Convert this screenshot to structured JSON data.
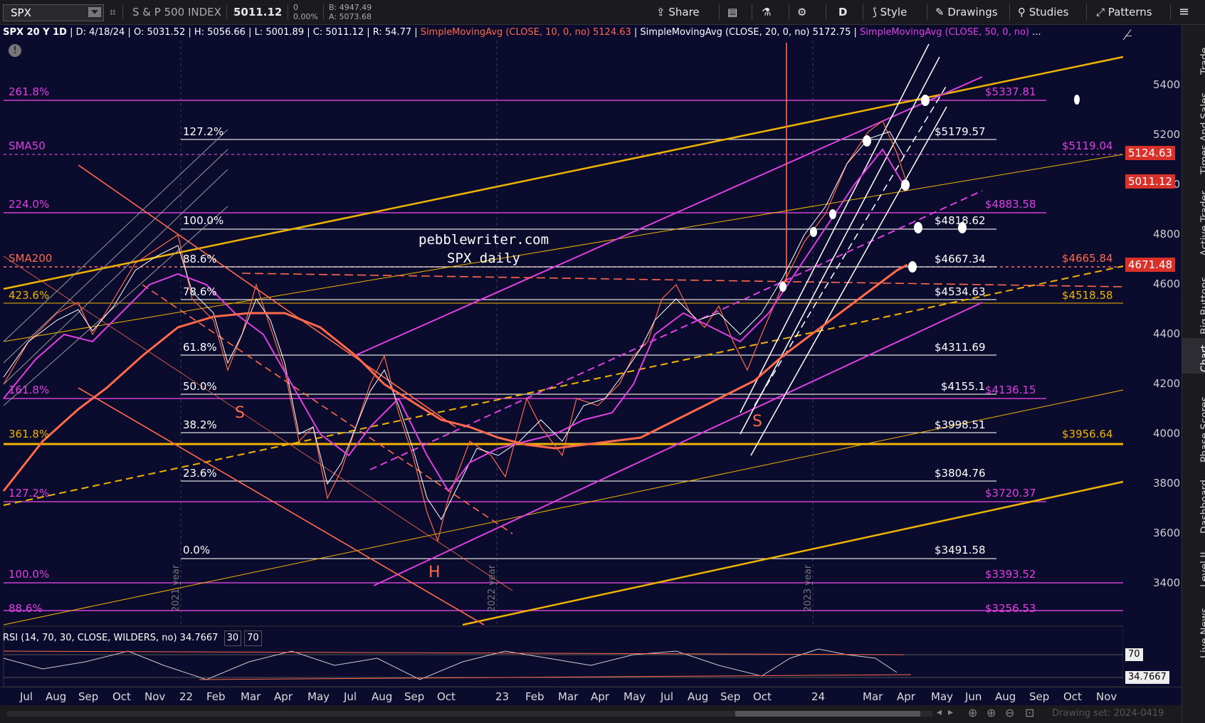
{
  "toolbar": {
    "symbol": "SPX",
    "name": "S & P 500 INDEX",
    "last": "5011.12",
    "change": "0",
    "change_pct": "0.00%",
    "bid": "B: 4947.49",
    "ask": "A: 5073.68",
    "share": "Share",
    "period": "D",
    "style": "Style",
    "drawings": "Drawings",
    "studies": "Studies",
    "patterns": "Patterns"
  },
  "info": {
    "title": "SPX 20 Y 1D",
    "date": "D: 4/18/24",
    "open": "O: 5031.52",
    "high": "H: 5056.66",
    "low": "L: 5001.89",
    "close": "C: 5011.12",
    "range": "R: 54.77",
    "sma10": "SimpleMovingAvg (CLOSE, 10, 0, no)",
    "sma10_val": "5124.63",
    "sma20": "SimpleMovingAvg (CLOSE, 20, 0, no)",
    "sma20_val": "5172.75",
    "sma50": "SimpleMovingAvg (CLOSE, 50, 0, no)",
    "more": "..."
  },
  "rsi": {
    "label": "RSI (14, 70, 30, CLOSE, WILDERS, no)",
    "value": "34.7667",
    "hi": "30",
    "lo": "70",
    "tag70": "70",
    "tag_val": "34.7667"
  },
  "watermark": {
    "line1": "pebblewriter.com",
    "line2": "SPX daily"
  },
  "letters": {
    "s1": "S",
    "h": "H",
    "s2": "S"
  },
  "price_ticks": [
    "5400",
    "5200",
    "5000",
    "4800",
    "4600",
    "4400",
    "4200",
    "4000",
    "3800",
    "3600",
    "3400"
  ],
  "tags": {
    "sma10": "5124.63",
    "last": "5011.12",
    "sma200": "4671.48"
  },
  "fib_left": {
    "f2618": "261.8%",
    "sma50": "SMA50",
    "f224": "224.0%",
    "sma200": "SMA200",
    "f4236": "423.6%",
    "f1618": "161.8%",
    "f3618": "361.8%",
    "f1272": "127.2%",
    "f100": "100.0%",
    "f886": "88.6%"
  },
  "fib_mid": {
    "f1272": "127.2%",
    "f100": "100.0%",
    "f886": "88.6%",
    "f786": "78.6%",
    "f618": "61.8%",
    "f50": "50.0%",
    "f382": "38.2%",
    "f236": "23.6%",
    "f0": "0.0%"
  },
  "fib_mid_prices": [
    "$5179.57",
    "$4818.62",
    "$4667.34",
    "$4534.63",
    "$4311.69",
    "$4155.1",
    "$3998.51",
    "$3804.76",
    "$3491.58"
  ],
  "fib_right_prices": {
    "p5337": "$5337.81",
    "p5119": "$5119.04",
    "p4883": "$4883.58",
    "p4665": "$4665.84",
    "p4518": "$4518.58",
    "p4136": "$4136.15",
    "p3956": "$3956.64",
    "p3720": "$3720.37",
    "p3393": "$3393.52",
    "p3256": "$3256.53"
  },
  "year_labels": [
    "2021 year",
    "2022 year",
    "2023 year"
  ],
  "x_labels": [
    "Jul",
    "Aug",
    "Sep",
    "Oct",
    "Nov",
    "22",
    "Feb",
    "Mar",
    "Apr",
    "May",
    "Jul",
    "Aug",
    "Sep",
    "Oct",
    "23",
    "Feb",
    "Mar",
    "Apr",
    "May",
    "Jul",
    "Aug",
    "Sep",
    "Oct",
    "24",
    "Mar",
    "Apr",
    "May",
    "Jun",
    "Aug",
    "Sep",
    "Oct",
    "Nov"
  ],
  "sidebar": [
    "Trade",
    "Times And Sales",
    "Active Trader",
    "Big Buttons",
    "Chart",
    "Phase Scores",
    "Dashboard",
    "Level II",
    "Live News"
  ],
  "bottom": {
    "drawing_set": "Drawing set: 2024-0419"
  },
  "colors": {
    "bg": "#0b0b2e",
    "magenta": "#e040e0",
    "orange": "#ff6a4a",
    "gold": "#f0b400",
    "white": "#ffffff"
  },
  "icons": [
    "share-icon",
    "news-icon",
    "flask-icon",
    "gear-icon",
    "style-icon",
    "drawings-icon",
    "studies-icon",
    "patterns-icon",
    "menu-icon"
  ]
}
